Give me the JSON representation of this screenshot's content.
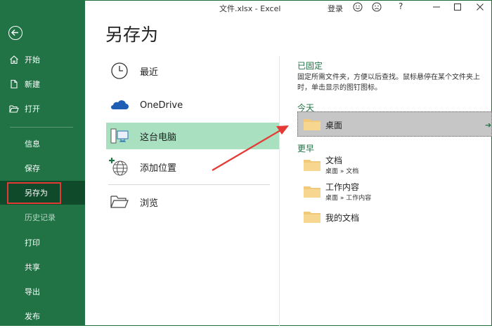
{
  "window": {
    "title": "文件.xlsx  -  Excel",
    "login": "登录",
    "help": "?"
  },
  "sidebar": {
    "items": [
      {
        "label": "开始",
        "icon": "home-icon"
      },
      {
        "label": "新建",
        "icon": "new-document-icon"
      },
      {
        "label": "打开",
        "icon": "open-folder-icon"
      },
      {
        "label": "信息"
      },
      {
        "label": "保存"
      },
      {
        "label": "另存为",
        "active": true
      },
      {
        "label": "历史记录",
        "disabled": true
      },
      {
        "label": "打印"
      },
      {
        "label": "共享"
      },
      {
        "label": "导出"
      },
      {
        "label": "发布"
      }
    ]
  },
  "page": {
    "title": "另存为"
  },
  "locations": [
    {
      "label": "最近",
      "icon": "clock-icon"
    },
    {
      "label": "OneDrive",
      "icon": "cloud-icon"
    },
    {
      "label": "这台电脑",
      "icon": "computer-icon",
      "selected": true
    },
    {
      "label": "添加位置",
      "icon": "globe-add-icon"
    },
    {
      "label": "浏览",
      "icon": "folder-open-icon"
    }
  ],
  "pinned": {
    "title": "已固定",
    "description_line1": "固定所需文件夹，方便以后查找。鼠标悬停在某个文件夹上",
    "description_line2": "时，单击显示的图钉图标。"
  },
  "today": {
    "title": "今天",
    "folders": [
      {
        "name": "桌面"
      }
    ]
  },
  "older": {
    "title": "更早",
    "folders": [
      {
        "name": "文档",
        "path": "桌面 » 文档"
      },
      {
        "name": "工作内容",
        "path": "桌面 » 工作内容"
      },
      {
        "name": "我的文档"
      }
    ]
  },
  "colors": {
    "sidebar": "#217346",
    "sidebar_active": "#0f4a2a",
    "selected_location": "#a9e1c0",
    "annotation": "#e53935",
    "folder": "#f1c97a"
  }
}
